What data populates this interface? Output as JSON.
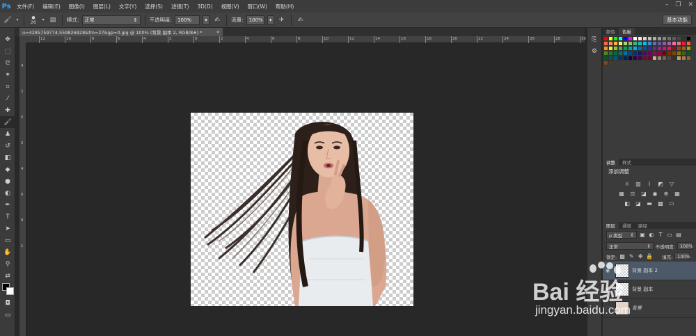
{
  "app": {
    "logo": "Ps"
  },
  "menu": [
    "文件(F)",
    "编辑(E)",
    "图像(I)",
    "图层(L)",
    "文字(Y)",
    "选择(S)",
    "滤镜(T)",
    "3D(D)",
    "视图(V)",
    "窗口(W)",
    "帮助(H)"
  ],
  "window_controls": {
    "minimize": "–",
    "restore": "❐",
    "close": "✕"
  },
  "options": {
    "brush_size": "26",
    "mode_label": "模式:",
    "mode_value": "正常",
    "opacity_label": "不透明度:",
    "opacity_value": "100%",
    "flow_label": "流量:",
    "flow_value": "100%",
    "workspace": "基本功能"
  },
  "document": {
    "tab_title": "u=4285759774,559826928&fm=27&gp=0.jpg @ 100% (背景 副本 2, RGB/8#) *",
    "tab_close": "×"
  },
  "hruler_ticks": [
    "12",
    "10",
    "8",
    "6",
    "4",
    "2",
    "0",
    "2",
    "4",
    "6",
    "8",
    "10",
    "12",
    "14",
    "16",
    "18",
    "20",
    "22",
    "24",
    "26",
    "28",
    "30"
  ],
  "vruler_ticks": [
    "4",
    "2",
    "0",
    "2",
    "4",
    "6",
    "8",
    "1"
  ],
  "tools": [
    {
      "name": "move-tool-icon",
      "glyph": "✥"
    },
    {
      "name": "marquee-tool-icon",
      "glyph": "⬚"
    },
    {
      "name": "lasso-tool-icon",
      "glyph": "ᘓ"
    },
    {
      "name": "magic-wand-tool-icon",
      "glyph": "✶"
    },
    {
      "name": "crop-tool-icon",
      "glyph": "⌗"
    },
    {
      "name": "eyedropper-tool-icon",
      "glyph": "⁄"
    },
    {
      "name": "healing-brush-tool-icon",
      "glyph": "✚"
    },
    {
      "name": "brush-tool-icon",
      "glyph": "🖌"
    },
    {
      "name": "stamp-tool-icon",
      "glyph": "♟"
    },
    {
      "name": "history-brush-tool-icon",
      "glyph": "↺"
    },
    {
      "name": "eraser-tool-icon",
      "glyph": "◧"
    },
    {
      "name": "paint-bucket-tool-icon",
      "glyph": "◆"
    },
    {
      "name": "blur-tool-icon",
      "glyph": "●"
    },
    {
      "name": "dodge-tool-icon",
      "glyph": "◐"
    },
    {
      "name": "pen-tool-icon",
      "glyph": "✒"
    },
    {
      "name": "type-tool-icon",
      "glyph": "T"
    },
    {
      "name": "path-select-tool-icon",
      "glyph": "➤"
    },
    {
      "name": "shape-tool-icon",
      "glyph": "▭"
    },
    {
      "name": "hand-tool-icon",
      "glyph": "✋"
    },
    {
      "name": "zoom-tool-icon",
      "glyph": "⚲"
    },
    {
      "name": "swap-colors-icon",
      "glyph": "⇄"
    }
  ],
  "panels": {
    "color_tabs": [
      "颜色",
      "色板"
    ],
    "adjust_tabs": [
      "调整",
      "样式"
    ],
    "adjust_title": "添加调整",
    "layer_tabs": [
      "图层",
      "通道",
      "路径"
    ],
    "layer_kind": "ρ 类型",
    "blend_mode": "正常",
    "opacity_label": "不透明度:",
    "opacity_value": "100%",
    "lock_label": "锁定:",
    "fill_label": "填充:",
    "fill_value": "100%",
    "layers": [
      {
        "name": "背景 副本 2",
        "selected": true
      },
      {
        "name": "背景 副本",
        "selected": false
      },
      {
        "name": "背景",
        "selected": false
      }
    ]
  },
  "watermark": {
    "text": "Bai 经验",
    "url": "jingyan.baidu.com"
  },
  "colors": {
    "accent": "#31a8ff",
    "selected_layer": "#4b5968",
    "panel": "#3b3b3b"
  }
}
